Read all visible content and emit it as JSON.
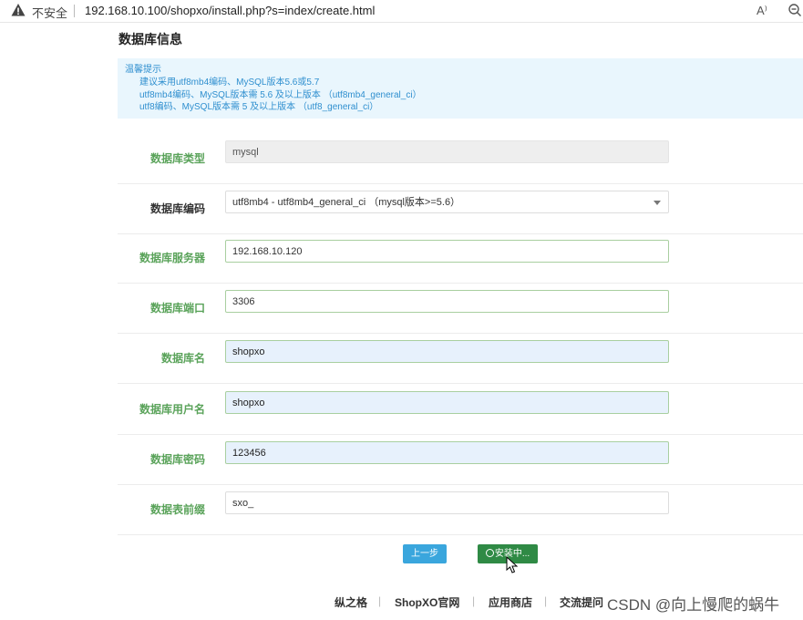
{
  "browser": {
    "security_label": "不安全",
    "url": "192.168.10.100/shopxo/install.php?s=index/create.html",
    "read_aloud_label": "A⁾"
  },
  "page": {
    "title": "数据库信息"
  },
  "tips": {
    "heading": "温馨提示",
    "lines": [
      "建议采用utf8mb4编码、MySQL版本5.6或5.7",
      "utf8mb4编码、MySQL版本需 5.6 及以上版本 （utf8mb4_general_ci）",
      "utf8编码、MySQL版本需 5 及以上版本 （utf8_general_ci）"
    ]
  },
  "form": {
    "db_type": {
      "label": "数据库类型",
      "value": "mysql"
    },
    "db_charset": {
      "label": "数据库编码",
      "value": "utf8mb4 - utf8mb4_general_ci （mysql版本>=5.6）"
    },
    "db_host": {
      "label": "数据库服务器",
      "value": "192.168.10.120"
    },
    "db_port": {
      "label": "数据库端口",
      "value": "3306"
    },
    "db_name": {
      "label": "数据库名",
      "value": "shopxo"
    },
    "db_user": {
      "label": "数据库用户名",
      "value": "shopxo"
    },
    "db_pass": {
      "label": "数据库密码",
      "value": "123456"
    },
    "db_prefix": {
      "label": "数据表前缀",
      "value": "sxo_"
    }
  },
  "actions": {
    "prev_label": "上一步",
    "install_label": "安装中..."
  },
  "footer": {
    "links": [
      "纵之格",
      "ShopXO官网",
      "应用商店",
      "交流提问"
    ],
    "separator": "|"
  },
  "watermark": "CSDN @向上慢爬的蜗牛"
}
